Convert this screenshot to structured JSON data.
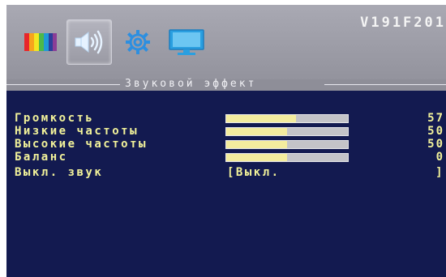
{
  "model": "V191F201",
  "tabs": [
    {
      "icon": "color-bars-icon",
      "active": false
    },
    {
      "icon": "speaker-icon",
      "active": true
    },
    {
      "icon": "gear-icon",
      "active": false
    },
    {
      "icon": "monitor-icon",
      "active": false
    }
  ],
  "section_title": "Звуковой эффект",
  "settings": [
    {
      "label": "Громкость",
      "value": "57",
      "level": 57
    },
    {
      "label": "Низкие частоты",
      "value": "50",
      "level": 50
    },
    {
      "label": "Высокие частоты",
      "value": "50",
      "level": 50
    },
    {
      "label": "Баланс",
      "value": "0",
      "level": 50
    }
  ],
  "mute": {
    "label": "Выкл. звук",
    "value": "[Выкл.",
    "close": "]"
  },
  "colors": {
    "screen_bg": "#131a50",
    "header_bg": "#a9a9b3",
    "text": "#f2f29a",
    "bar_fill": "#f4ec9e",
    "bar_track": "#c4c4c8"
  }
}
